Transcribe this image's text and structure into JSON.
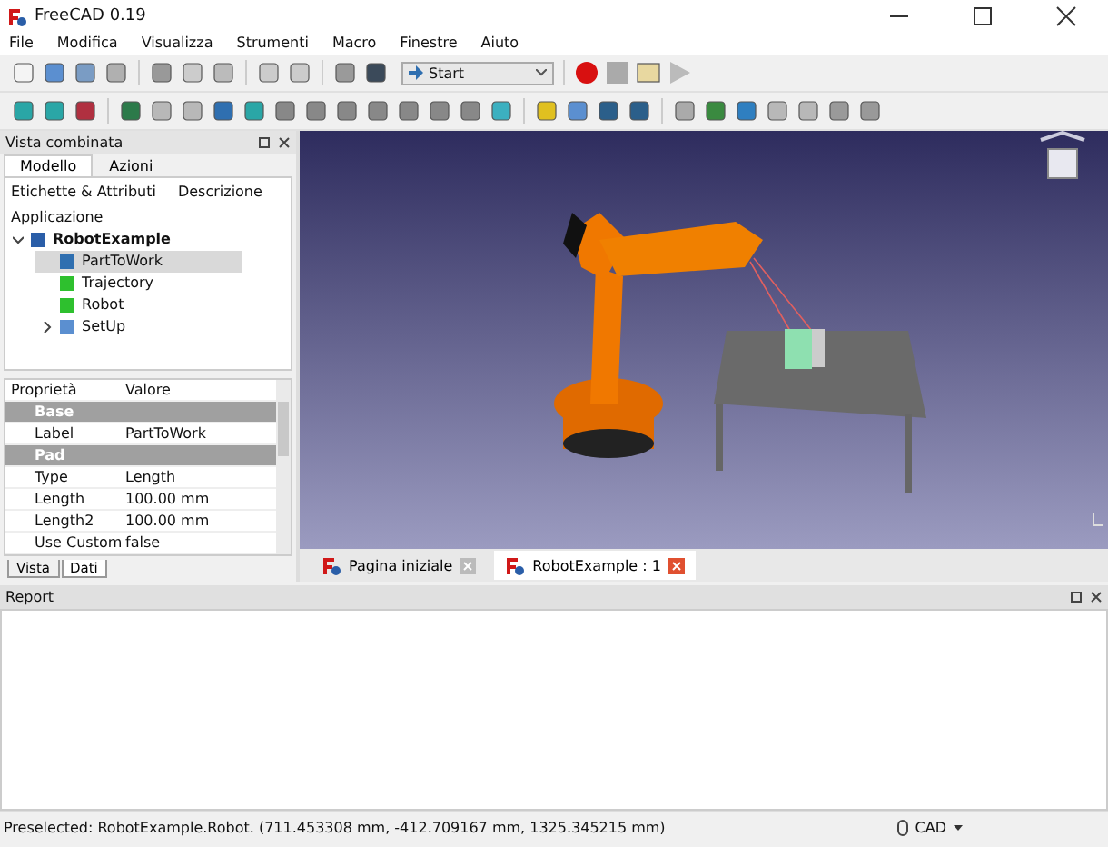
{
  "window": {
    "title": "FreeCAD 0.19"
  },
  "menu": [
    "File",
    "Modifica",
    "Visualizza",
    "Strumenti",
    "Macro",
    "Finestre",
    "Aiuto"
  ],
  "workbench": {
    "value": "Start"
  },
  "combo_view": {
    "title": "Vista combinata",
    "tabs": [
      {
        "label": "Modello",
        "selected": true
      },
      {
        "label": "Azioni",
        "selected": false
      }
    ],
    "tree_columns": [
      "Etichette & Attributi",
      "Descrizione"
    ],
    "tree_root_label": "Applicazione",
    "tree": [
      {
        "label": "RobotExample",
        "kind": "document",
        "expanded": true,
        "selected": false,
        "children": [
          {
            "label": "PartToWork",
            "kind": "part",
            "selected": true
          },
          {
            "label": "Trajectory",
            "kind": "trajectory",
            "selected": false
          },
          {
            "label": "Robot",
            "kind": "robot",
            "selected": false
          },
          {
            "label": "SetUp",
            "kind": "folder",
            "expanded": false,
            "selected": false
          }
        ]
      }
    ],
    "property_columns": [
      "Proprietà",
      "Valore"
    ],
    "properties": [
      {
        "kind": "group",
        "name": "Base"
      },
      {
        "kind": "prop",
        "name": "Label",
        "value": "PartToWork"
      },
      {
        "kind": "group",
        "name": "Pad"
      },
      {
        "kind": "prop",
        "name": "Type",
        "value": "Length"
      },
      {
        "kind": "prop",
        "name": "Length",
        "value": "100.00 mm"
      },
      {
        "kind": "prop",
        "name": "Length2",
        "value": "100.00 mm"
      },
      {
        "kind": "prop",
        "name": "Use Custom",
        "value": "false"
      }
    ],
    "bottom_tabs": [
      {
        "label": "Vista",
        "selected": false
      },
      {
        "label": "Dati",
        "selected": true
      }
    ]
  },
  "document_tabs": [
    {
      "label": "Pagina iniziale",
      "selected": false
    },
    {
      "label": "RobotExample : 1",
      "selected": true
    }
  ],
  "report": {
    "title": "Report"
  },
  "status_bar": {
    "message": "Preselected: RobotExample.Robot. (711.453308 mm, -412.709167 mm, 1325.345215 mm)",
    "navigation": "CAD"
  }
}
